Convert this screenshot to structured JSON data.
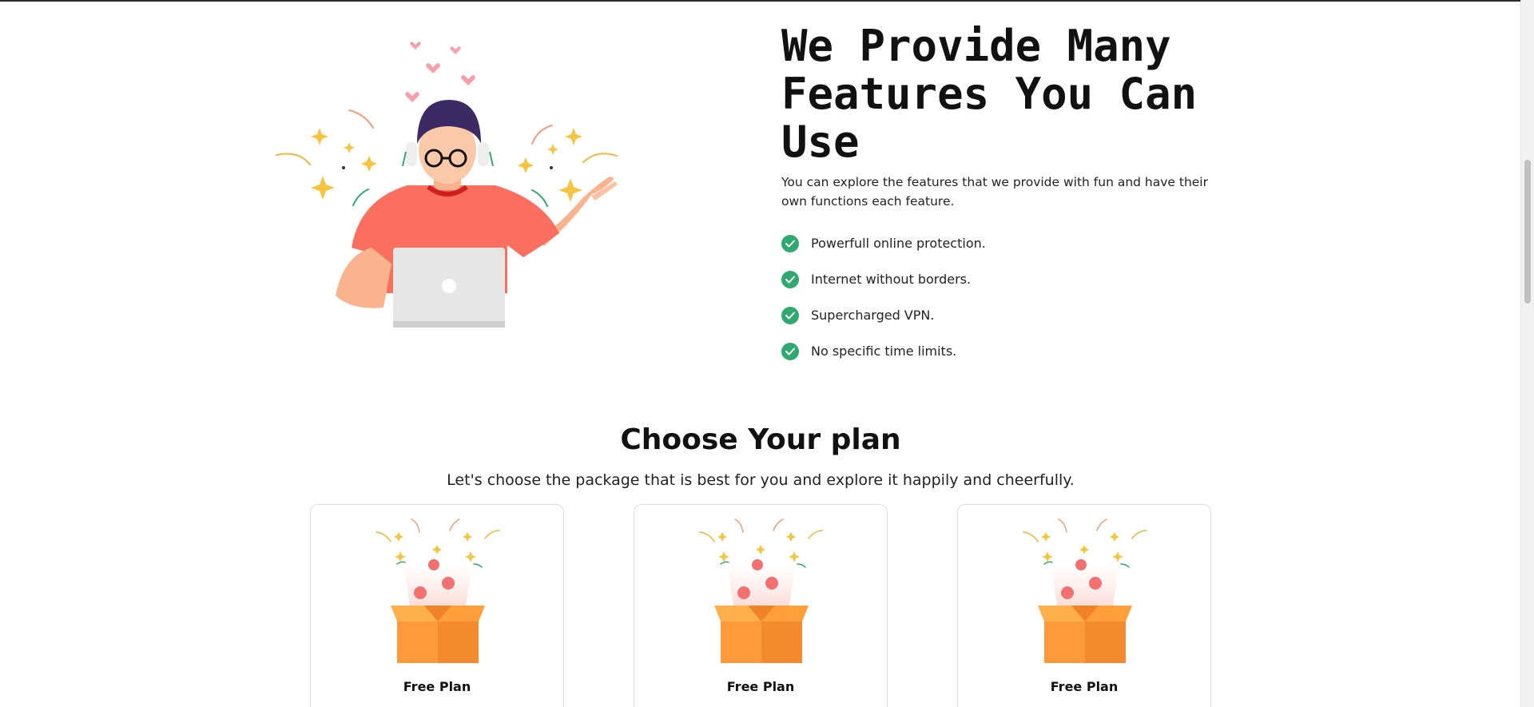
{
  "features": {
    "title": "We Provide Many Features You Can Use",
    "description": "You can explore the features that we provide with fun and have their own functions each feature.",
    "items": [
      "Powerfull online protection.",
      "Internet without borders.",
      "Supercharged VPN.",
      "No specific time limits."
    ],
    "check_icon": "check-circle-icon"
  },
  "plans": {
    "title": "Choose Your plan",
    "subtitle": "Let's choose the package that is best for you and explore it happily and cheerfully.",
    "cards": [
      {
        "name": "Free Plan",
        "icon": "gift-box-icon"
      },
      {
        "name": "Free Plan",
        "icon": "gift-box-icon"
      },
      {
        "name": "Free Plan",
        "icon": "gift-box-icon"
      }
    ]
  },
  "colors": {
    "check": "#2fa96f",
    "shirt": "#fa6f5e",
    "box": "#ff9a3c"
  }
}
